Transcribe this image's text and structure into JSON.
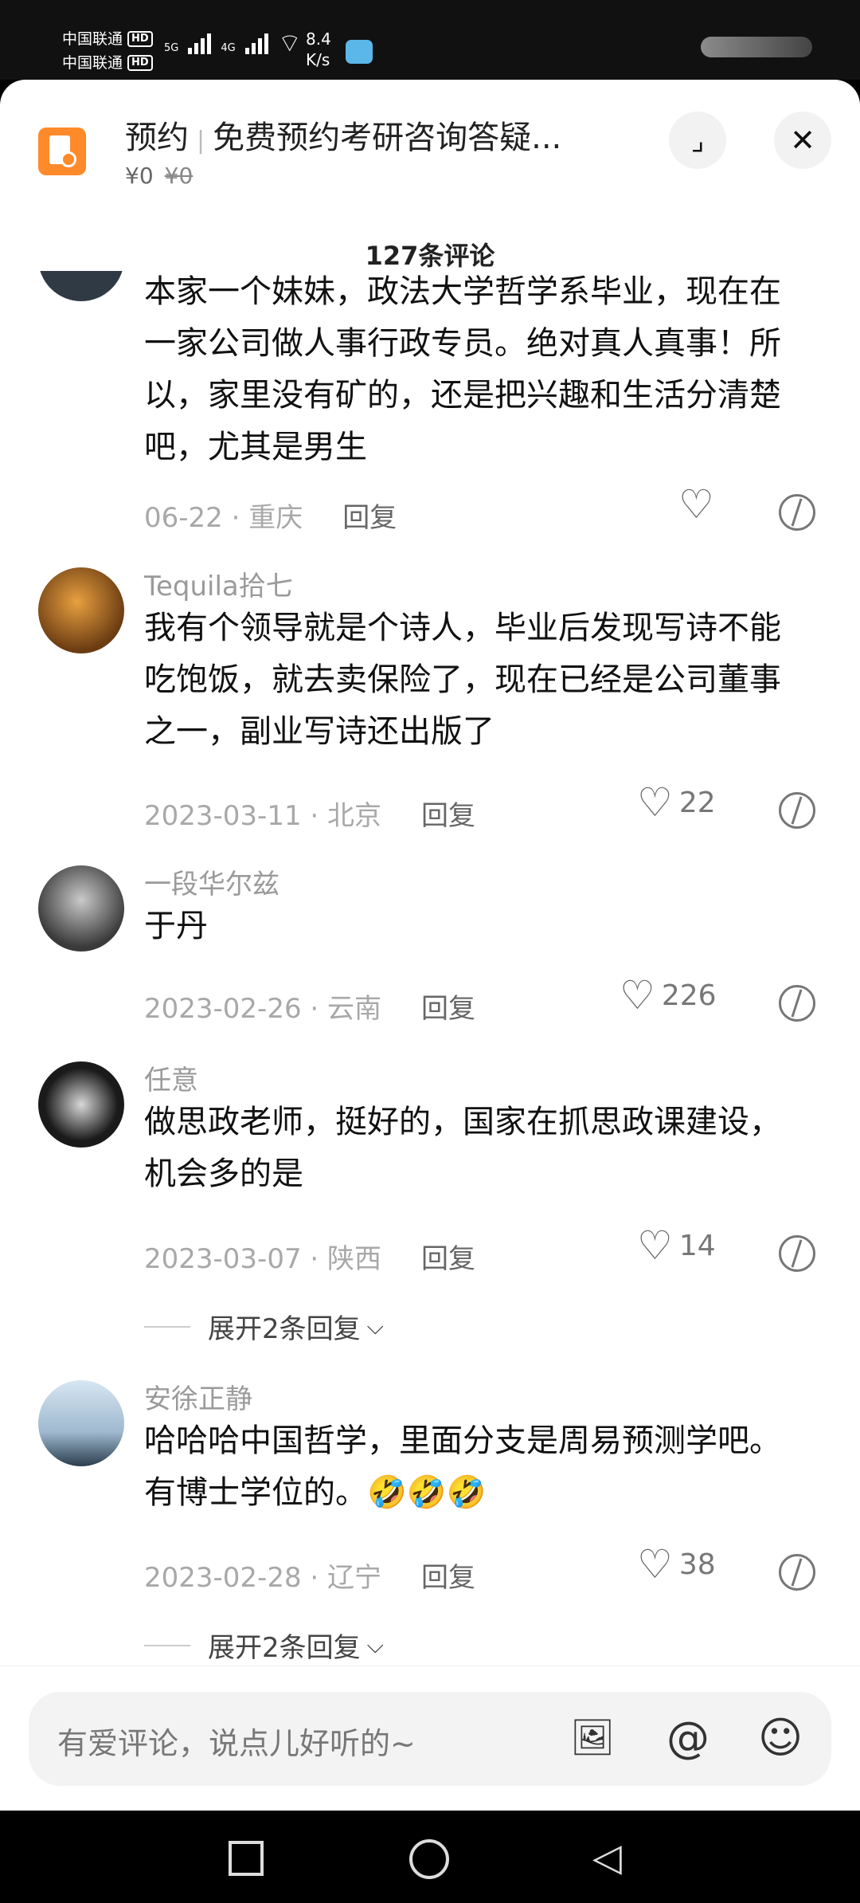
{
  "status_bar": {
    "carrier1": "中国联通",
    "carrier2": "中国联通",
    "hd": "HD",
    "net1": "5G",
    "net2": "4G",
    "speed_value": "8.4",
    "speed_unit": "K/s"
  },
  "header": {
    "tag": "预约",
    "title": "免费预约考研咨询答疑...",
    "price": "¥0",
    "original_price": "¥0"
  },
  "comments_header": {
    "count": "127条评论"
  },
  "comments": [
    {
      "name": "",
      "text": "本家一个妹妹，政法大学哲学系毕业，现在在一家公司做人事行政专员。绝对真人真事！所以，家里没有矿的，还是把兴趣和生活分清楚吧，尤其是男生",
      "meta": "06-22 · 重庆",
      "reply": "回复",
      "likes": ""
    },
    {
      "name": "Tequila拾七",
      "text": "我有个领导就是个诗人，毕业后发现写诗不能吃饱饭，就去卖保险了，现在已经是公司董事之一，副业写诗还出版了",
      "meta": "2023-03-11 · 北京",
      "reply": "回复",
      "likes": "22"
    },
    {
      "name": "一段华尔兹",
      "text": "于丹",
      "meta": "2023-02-26 · 云南",
      "reply": "回复",
      "likes": "226"
    },
    {
      "name": "任意",
      "text": "做思政老师，挺好的，国家在抓思政课建设，机会多的是",
      "meta": "2023-03-07 · 陕西",
      "reply": "回复",
      "likes": "14",
      "expand": "展开2条回复"
    },
    {
      "name": "安徐正静",
      "text": "哈哈哈中国哲学，里面分支是周易预测学吧。有博士学位的。🤣🤣🤣",
      "meta": "2023-02-28 · 辽宁",
      "reply": "回复",
      "likes": "38",
      "expand": "展开2条回复"
    }
  ],
  "input": {
    "placeholder": "有爱评论，说点儿好听的~"
  },
  "icons": {
    "image": "image-icon",
    "mention": "at-icon",
    "emoji": "emoji-icon"
  },
  "colors": {
    "app_icon": "#ff8a2a",
    "background": "#ffffff",
    "text": "#111111",
    "muted": "#9a9a9a"
  }
}
